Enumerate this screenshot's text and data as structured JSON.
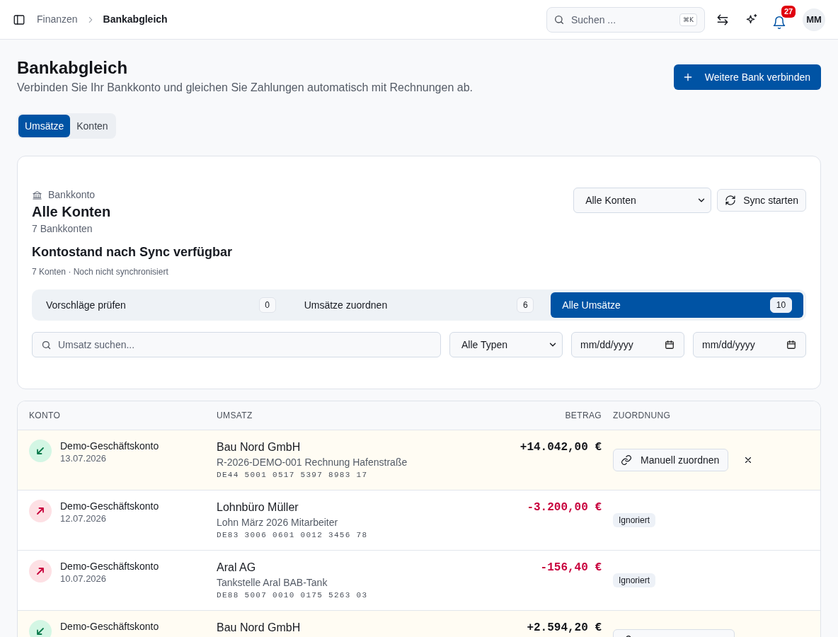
{
  "topbar": {
    "breadcrumb": [
      {
        "label": "Finanzen",
        "current": false
      },
      {
        "label": "Bankabgleich",
        "current": true
      }
    ],
    "search": {
      "placeholder": "Suchen ...",
      "shortcut": "⌘K"
    },
    "notifications": {
      "count": "27"
    },
    "avatar": {
      "initials": "MM"
    }
  },
  "header": {
    "title": "Bankabgleich",
    "subtitle": "Verbinden Sie Ihr Bankkonto und gleichen Sie Zahlungen automatisch mit Rechnungen ab.",
    "action": "Weitere Bank verbinden"
  },
  "view_tabs": [
    {
      "label": "Umsätze",
      "selected": true
    },
    {
      "label": "Konten",
      "selected": false
    }
  ],
  "account_panel": {
    "eyebrow": "Bankkonto",
    "title": "Alle Konten",
    "account_count": "7 Bankkonten",
    "balance": "Kontostand nach Sync verfügbar",
    "status": "7 Konten · Noch nicht synchronisiert",
    "account_select": "Alle Konten",
    "sync_button": "Sync starten"
  },
  "filter_tabs": [
    {
      "label": "Vorschläge prüfen",
      "count": "0",
      "selected": false
    },
    {
      "label": "Umsätze zuordnen",
      "count": "6",
      "selected": false
    },
    {
      "label": "Alle Umsätze",
      "count": "10",
      "selected": true
    }
  ],
  "filters": {
    "search": {
      "placeholder": "Umsatz suchen..."
    },
    "type_select": "Alle Typen",
    "date_from": {
      "placeholder": "mm/dd/yyyy"
    },
    "date_to": {
      "placeholder": "mm/dd/yyyy"
    }
  },
  "table": {
    "columns": [
      "KONTO",
      "UMSATZ",
      "BETRAG",
      "ZUORDNUNG"
    ],
    "rows": [
      {
        "kind": "incoming",
        "highlighted": true,
        "account": "Demo-Geschäftskonto",
        "date": "13.07.2026",
        "counterparty": "Bau Nord GmbH",
        "reference": "R-2026-DEMO-001 Rechnung Hafenstraße",
        "iban": "DE44 5001 0517 5397 8983 17",
        "amount": "+14.042,00 €",
        "assignment": {
          "kind": "manual",
          "label": "Manuell zuordnen",
          "dismissible": true
        }
      },
      {
        "kind": "outgoing",
        "highlighted": false,
        "account": "Demo-Geschäftskonto",
        "date": "12.07.2026",
        "counterparty": "Lohnbüro Müller",
        "reference": "Lohn März 2026 Mitarbeiter",
        "iban": "DE83 3006 0601 0012 3456 78",
        "amount": "-3.200,00 €",
        "assignment": {
          "kind": "ignored",
          "label": "Ignoriert"
        }
      },
      {
        "kind": "outgoing",
        "highlighted": false,
        "account": "Demo-Geschäftskonto",
        "date": "10.07.2026",
        "counterparty": "Aral AG",
        "reference": "Tankstelle Aral BAB-Tank",
        "iban": "DE88 5007 0010 0175 5263 03",
        "amount": "-156,40 €",
        "assignment": {
          "kind": "ignored",
          "label": "Ignoriert"
        }
      },
      {
        "kind": "incoming",
        "highlighted": true,
        "account": "Demo-Geschäftskonto",
        "counterparty": "Bau Nord GmbH",
        "amount": "+2.594,20 €",
        "assignment": {
          "kind": "manual"
        }
      }
    ]
  }
}
